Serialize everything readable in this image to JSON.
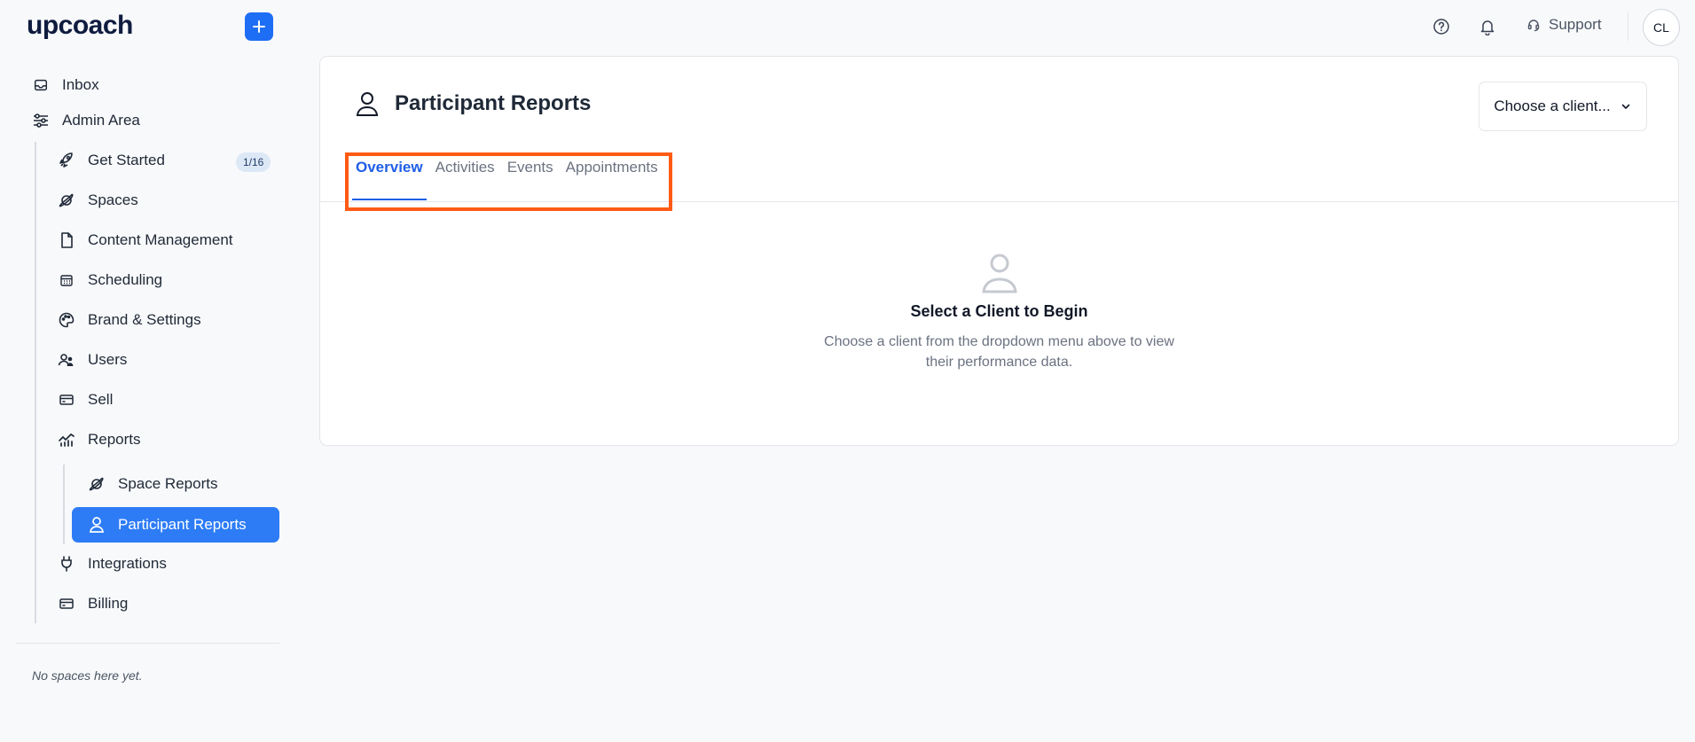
{
  "brand": {
    "logo": "upcoach"
  },
  "sidebar": {
    "items": [
      {
        "label": "Inbox",
        "icon": "inbox-icon"
      },
      {
        "label": "Admin Area",
        "icon": "sliders-icon"
      },
      {
        "label": "Get Started",
        "icon": "rocket-icon",
        "badge": "1/16"
      },
      {
        "label": "Spaces",
        "icon": "planet-icon"
      },
      {
        "label": "Content Management",
        "icon": "file-icon"
      },
      {
        "label": "Scheduling",
        "icon": "calendar-icon"
      },
      {
        "label": "Brand & Settings",
        "icon": "palette-icon"
      },
      {
        "label": "Users",
        "icon": "users-icon"
      },
      {
        "label": "Sell",
        "icon": "card-icon"
      },
      {
        "label": "Reports",
        "icon": "chart-icon"
      },
      {
        "label": "Space Reports",
        "icon": "planet-icon"
      },
      {
        "label": "Participant Reports",
        "icon": "user-icon",
        "active": true
      },
      {
        "label": "Integrations",
        "icon": "plug-icon"
      },
      {
        "label": "Billing",
        "icon": "billing-icon"
      }
    ],
    "empty_spaces": "No spaces here yet."
  },
  "topbar": {
    "support_label": "Support",
    "avatar_initials": "CL"
  },
  "page": {
    "title": "Participant Reports",
    "client_select_label": "Choose a client...",
    "tabs": [
      {
        "label": "Overview",
        "active": true
      },
      {
        "label": "Activities"
      },
      {
        "label": "Events"
      },
      {
        "label": "Appointments"
      }
    ],
    "empty_state": {
      "title": "Select a Client to Begin",
      "description": "Choose a client from the dropdown menu above to view their performance data."
    }
  },
  "colors": {
    "accent": "#1e6ef5",
    "active_nav": "#2d7cf6",
    "highlight": "#ff5b14"
  }
}
